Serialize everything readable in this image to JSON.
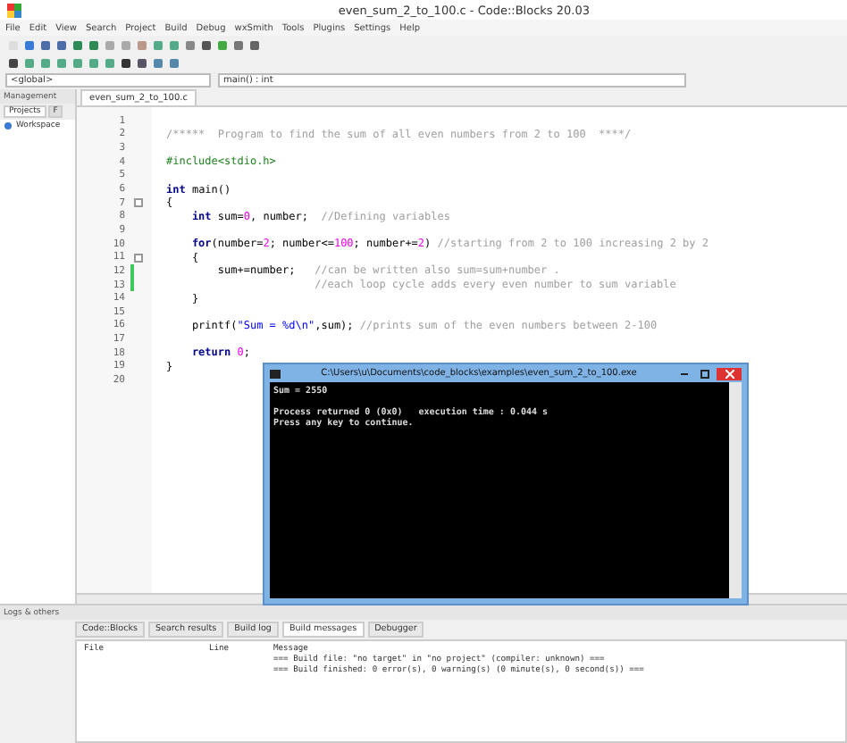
{
  "window": {
    "title": "even_sum_2_to_100.c - Code::Blocks 20.03"
  },
  "menu": [
    "File",
    "Edit",
    "View",
    "Search",
    "Project",
    "Build",
    "Debug",
    "wxSmith",
    "Tools",
    "Plugins",
    "Settings",
    "Help"
  ],
  "scope": {
    "left": "<global>",
    "right": "main() : int"
  },
  "management": {
    "title": "Management",
    "tabs": [
      {
        "label": "Projects",
        "selected": true
      },
      {
        "label": "F",
        "selected": false
      }
    ],
    "tree": [
      "Workspace"
    ]
  },
  "editor": {
    "tab": "even_sum_2_to_100.c",
    "lines": [
      {
        "number": "1"
      },
      {
        "number": "2",
        "segments": [
          {
            "kind": "comment",
            "text": "/*****  Program to find the sum of all even numbers from 2 to 100  ****/"
          }
        ]
      },
      {
        "number": "3"
      },
      {
        "number": "4",
        "segments": [
          {
            "kind": "preprocessor",
            "text": "#include<stdio.h>"
          }
        ]
      },
      {
        "number": "5"
      },
      {
        "number": "6",
        "segments": [
          {
            "kind": "keyword",
            "text": "int"
          },
          {
            "kind": "plain",
            "text": " main()"
          }
        ]
      },
      {
        "number": "7",
        "fold": true,
        "segments": [
          {
            "kind": "plain",
            "text": "{"
          }
        ]
      },
      {
        "number": "8",
        "segments": [
          {
            "kind": "keyword",
            "text": "    int"
          },
          {
            "kind": "plain",
            "text": " sum="
          },
          {
            "kind": "number",
            "text": "0"
          },
          {
            "kind": "plain",
            "text": ", number;  "
          },
          {
            "kind": "comment",
            "text": "//Defining variables"
          }
        ]
      },
      {
        "number": "9"
      },
      {
        "number": "10",
        "segments": [
          {
            "kind": "keyword",
            "text": "    for"
          },
          {
            "kind": "plain",
            "text": "(number="
          },
          {
            "kind": "number",
            "text": "2"
          },
          {
            "kind": "plain",
            "text": "; number<="
          },
          {
            "kind": "number",
            "text": "100"
          },
          {
            "kind": "plain",
            "text": "; number+="
          },
          {
            "kind": "number",
            "text": "2"
          },
          {
            "kind": "plain",
            "text": ") "
          },
          {
            "kind": "comment",
            "text": "//starting from 2 to 100 increasing 2 by 2"
          }
        ]
      },
      {
        "number": "11",
        "fold": true,
        "segments": [
          {
            "kind": "plain",
            "text": "    {"
          }
        ]
      },
      {
        "number": "12",
        "changed": true,
        "segments": [
          {
            "kind": "plain",
            "text": "        sum+=number;   "
          },
          {
            "kind": "comment",
            "text": "//can be written also sum=sum+number ."
          }
        ]
      },
      {
        "number": "13",
        "changed": true,
        "segments": [
          {
            "kind": "comment",
            "text": "                       //each loop cycle adds every even number to sum variable"
          }
        ]
      },
      {
        "number": "14",
        "segments": [
          {
            "kind": "plain",
            "text": "    }"
          }
        ]
      },
      {
        "number": "15"
      },
      {
        "number": "16",
        "segments": [
          {
            "kind": "plain",
            "text": "    printf("
          },
          {
            "kind": "string",
            "text": "\"Sum = %d\\n\""
          },
          {
            "kind": "plain",
            "text": ",sum); "
          },
          {
            "kind": "comment",
            "text": "//prints sum of the even numbers between 2-100"
          }
        ]
      },
      {
        "number": "17"
      },
      {
        "number": "18",
        "segments": [
          {
            "kind": "keyword",
            "text": "    return "
          },
          {
            "kind": "number",
            "text": "0"
          },
          {
            "kind": "plain",
            "text": ";"
          }
        ]
      },
      {
        "number": "19",
        "segments": [
          {
            "kind": "plain",
            "text": "}"
          }
        ]
      },
      {
        "number": "20"
      }
    ]
  },
  "console": {
    "title": "C:\\Users\\u\\Documents\\code_blocks\\examples\\even_sum_2_to_100.exe",
    "output": [
      "Sum = 2550"
    ],
    "status": [
      "Process returned 0 (0x0)   execution time : 0.044 s",
      "Press any key to continue."
    ]
  },
  "logs": {
    "title": "Logs & others",
    "tabs": [
      {
        "label": "Code::Blocks",
        "selected": false
      },
      {
        "label": "Search results",
        "selected": false
      },
      {
        "label": "Build log",
        "selected": false
      },
      {
        "label": "Build messages",
        "selected": true
      },
      {
        "label": "Debugger",
        "selected": false
      }
    ],
    "columns": [
      "File",
      "Line",
      "Message"
    ],
    "messages": [
      "=== Build file: \"no target\" in \"no project\" (compiler: unknown) ===",
      "=== Build finished: 0 error(s), 0 warning(s) (0 minute(s), 0 second(s)) ==="
    ]
  }
}
